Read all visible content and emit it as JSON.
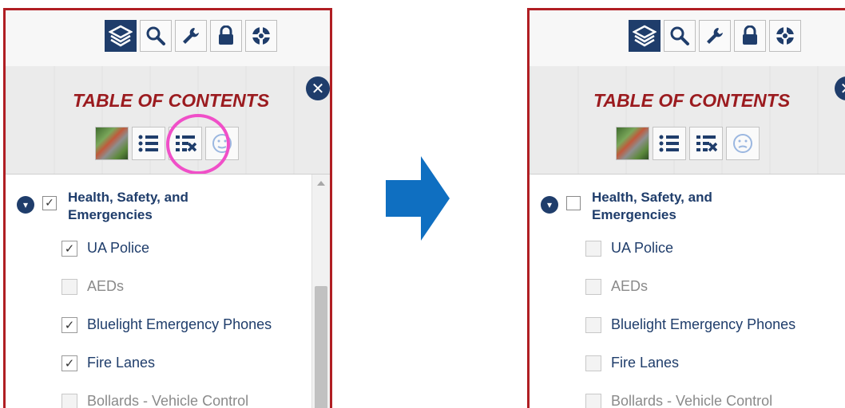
{
  "accent": "#1f3d6b",
  "border": "#b01e23",
  "highlight": "#f04fc8",
  "toolbar": {
    "icons": [
      "layers-icon",
      "search-icon",
      "wrench-icon",
      "lock-icon",
      "lifebuoy-icon"
    ]
  },
  "close_glyph": "✕",
  "title": "TABLE OF CONTENTS",
  "check": "✓",
  "chevron": "▾",
  "left": {
    "group": {
      "label_line1": "Health, Safety, and",
      "label_line2": "Emergencies",
      "checked": true
    },
    "items": [
      {
        "label": "UA Police",
        "checked": true
      },
      {
        "label": "AEDs",
        "checked": false
      },
      {
        "label": "Bluelight Emergency Phones",
        "checked": true
      },
      {
        "label": "Fire Lanes",
        "checked": true
      },
      {
        "label": "Bollards - Vehicle Control",
        "checked": false
      }
    ]
  },
  "right": {
    "group": {
      "label_line1": "Health, Safety, and",
      "label_line2": "Emergencies",
      "checked": false
    },
    "items": [
      {
        "label": "UA Police",
        "checked": false
      },
      {
        "label": "AEDs",
        "checked": false
      },
      {
        "label": "Bluelight Emergency Phones",
        "checked": false
      },
      {
        "label": "Fire Lanes",
        "checked": false
      },
      {
        "label": "Bollards - Vehicle Control",
        "checked": false
      }
    ]
  }
}
